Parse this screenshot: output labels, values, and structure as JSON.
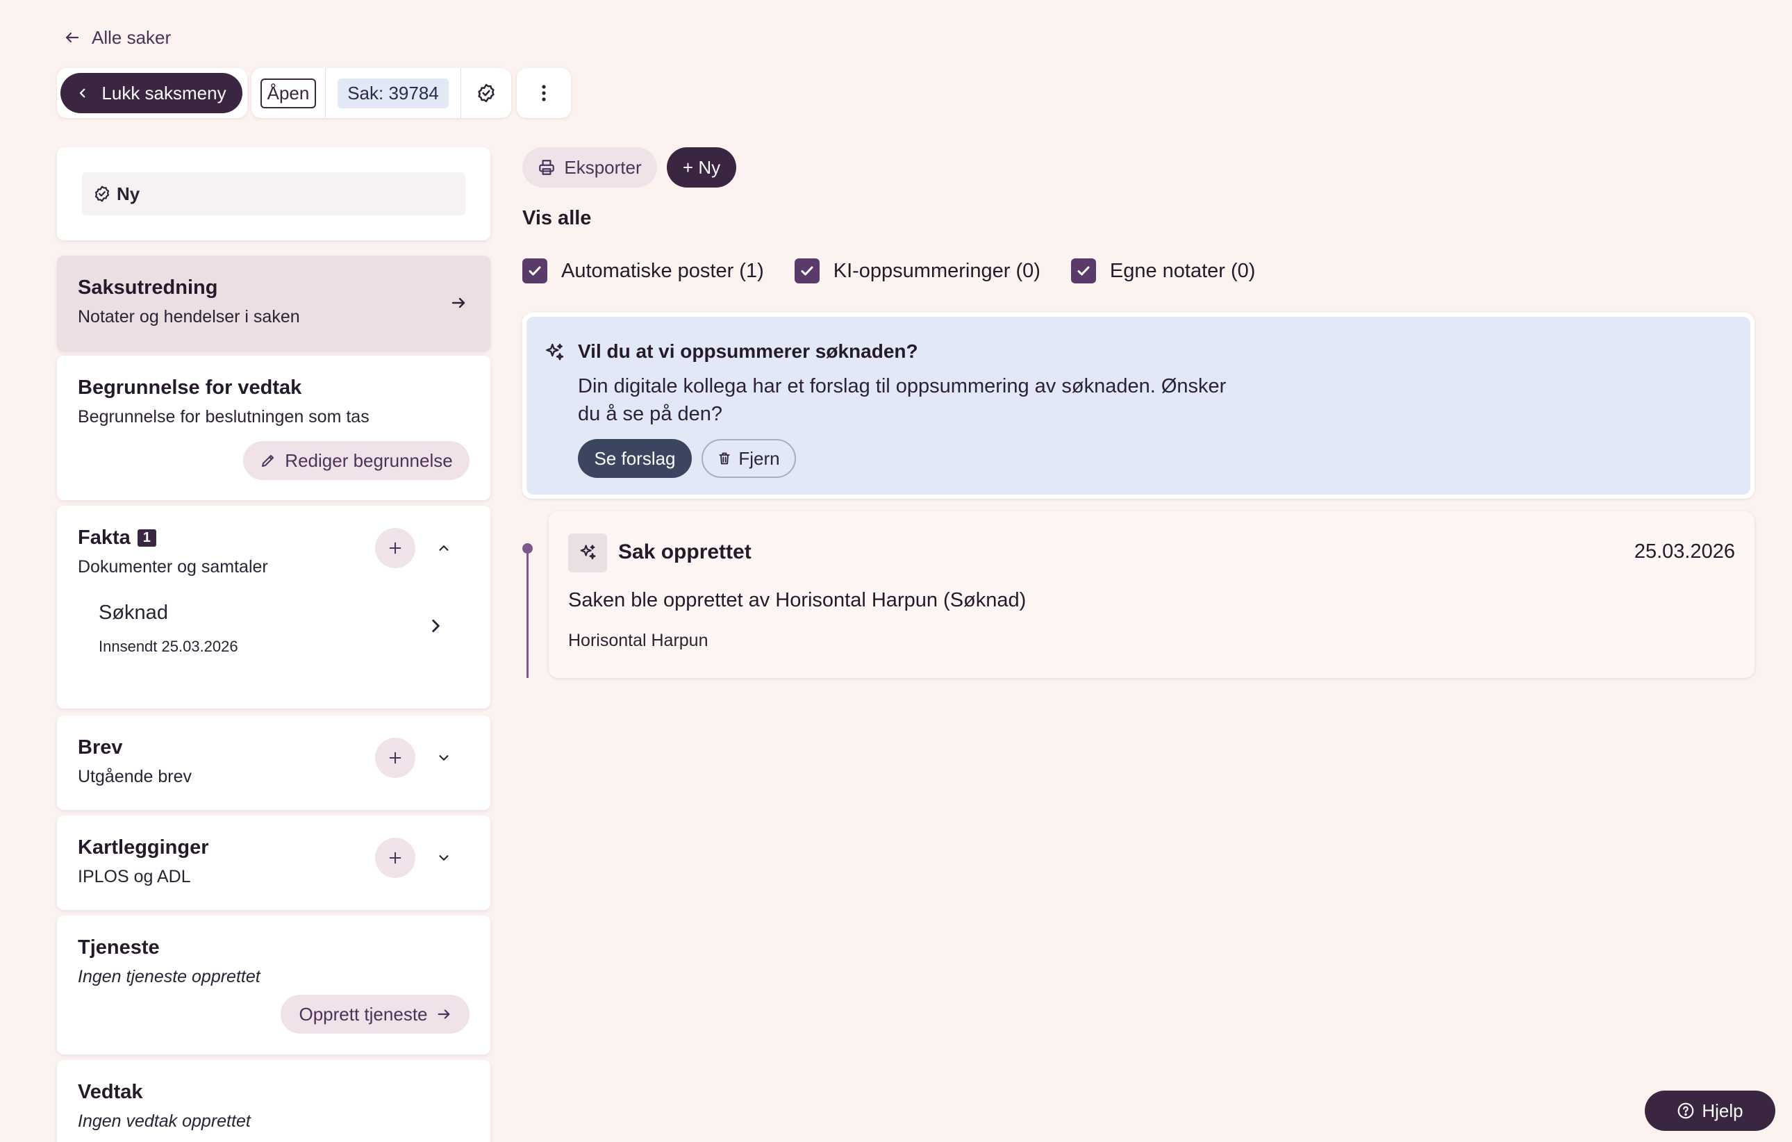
{
  "nav": {
    "back_label": "Alle saker"
  },
  "toolbar": {
    "close_menu_label": "Lukk saksmeny",
    "status_label": "Åpen",
    "case_label": "Sak: 39784"
  },
  "sidebar": {
    "status_card": {
      "label": "Ny"
    },
    "saksutredning": {
      "title": "Saksutredning",
      "subtitle": "Notater og hendelser i saken"
    },
    "begrunnelse": {
      "title": "Begrunnelse for vedtak",
      "subtitle": "Begrunnelse for beslutningen som tas",
      "button": "Rediger begrunnelse"
    },
    "fakta": {
      "title": "Fakta",
      "count": "1",
      "subtitle": "Dokumenter og samtaler",
      "items": [
        {
          "title": "Søknad",
          "meta": "Innsendt 25.03.2026"
        }
      ]
    },
    "brev": {
      "title": "Brev",
      "subtitle": "Utgående brev"
    },
    "kartlegginger": {
      "title": "Kartlegginger",
      "subtitle": "IPLOS og ADL"
    },
    "tjeneste": {
      "title": "Tjeneste",
      "subtitle": "Ingen tjeneste opprettet",
      "button": "Opprett tjeneste"
    },
    "vedtak": {
      "title": "Vedtak",
      "subtitle": "Ingen vedtak opprettet"
    }
  },
  "main": {
    "export_label": "Eksporter",
    "new_label": "+ Ny",
    "filter_heading": "Vis alle",
    "filters": [
      {
        "label": "Automatiske poster (1)",
        "checked": true
      },
      {
        "label": "KI-oppsummeringer (0)",
        "checked": true
      },
      {
        "label": "Egne notater (0)",
        "checked": true
      }
    ],
    "suggestion": {
      "title": "Vil du at vi oppsummerer søknaden?",
      "text_line1": "Din digitale kollega har et forslag til oppsummering av søknaden. Ønsker",
      "text_line2": "du å se på den?",
      "primary": "Se forslag",
      "secondary": "Fjern"
    },
    "timeline": [
      {
        "title": "Sak opprettet",
        "date": "25.03.2026",
        "body": "Saken ble opprettet av Horisontal Harpun (Søknad)",
        "author": "Horisontal Harpun"
      }
    ]
  },
  "help": {
    "label": "Hjelp"
  },
  "colors": {
    "accent_dark": "#3a2640",
    "checkbox": "#5a3a68",
    "suggestion_bg": "#e3e8f7",
    "page_bg": "#fcf3f1"
  }
}
